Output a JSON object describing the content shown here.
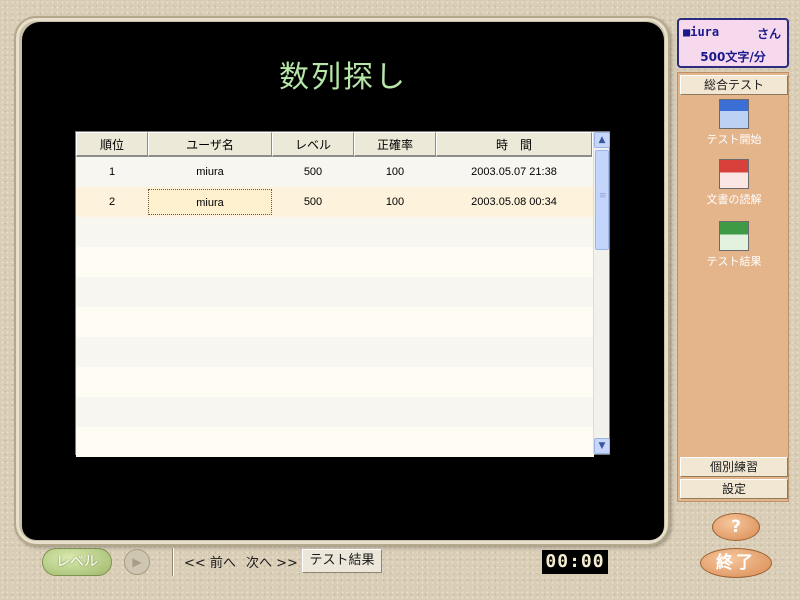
{
  "page": {
    "title": "数列探し"
  },
  "table": {
    "headers": [
      "順位",
      "ユーザ名",
      "レベル",
      "正確率",
      "時　間"
    ],
    "rows": [
      [
        "1",
        "miura",
        "500",
        "100",
        "2003.05.07 21:38"
      ],
      [
        "2",
        "miura",
        "500",
        "100",
        "2003.05.08 00:34"
      ]
    ],
    "empty_rows": 8,
    "scroll": {
      "up": "▲",
      "down": "▼"
    }
  },
  "bottom_bar": {
    "level_label": "レベル",
    "play_icon": "▶",
    "prev_label": "<< 前へ",
    "next_label": "次へ >>",
    "result_label": "テスト結果",
    "timer": "00:00"
  },
  "user": {
    "name": "■iura",
    "suffix": "さん",
    "speed": "500文字/分"
  },
  "side_panel": {
    "overall_test": "総合テスト",
    "tools": [
      {
        "label": "テスト開始",
        "icon": "test-start-icon"
      },
      {
        "label": "文書の読解",
        "icon": "document-reading-icon"
      },
      {
        "label": "テスト結果",
        "icon": "test-result-icon"
      }
    ],
    "individual_practice": "個別練習",
    "settings": "設定"
  },
  "buttons": {
    "help": "?",
    "exit": "終了"
  }
}
